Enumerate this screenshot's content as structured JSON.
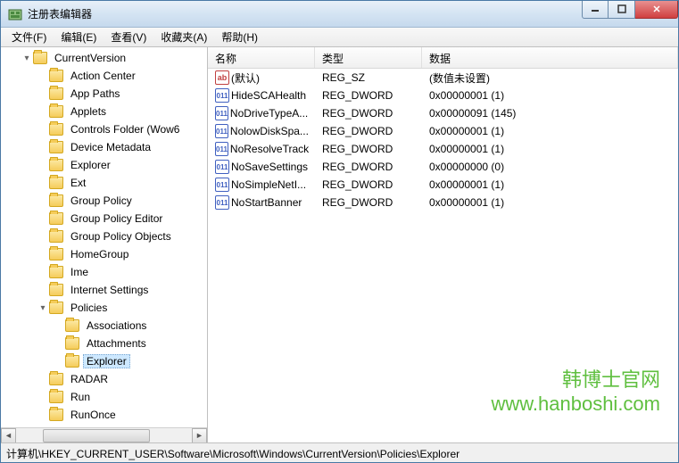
{
  "window": {
    "title": "注册表编辑器"
  },
  "menu": {
    "file": "文件(F)",
    "edit": "编辑(E)",
    "view": "查看(V)",
    "favorites": "收藏夹(A)",
    "help": "帮助(H)"
  },
  "tree": {
    "root": "CurrentVersion",
    "items": [
      "Action Center",
      "App Paths",
      "Applets",
      "Controls Folder (Wow6",
      "Device Metadata",
      "Explorer",
      "Ext",
      "Group Policy",
      "Group Policy Editor",
      "Group Policy Objects",
      "HomeGroup",
      "Ime",
      "Internet Settings"
    ],
    "policies": {
      "label": "Policies",
      "children": [
        "Associations",
        "Attachments",
        "Explorer"
      ]
    },
    "after": [
      "RADAR",
      "Run",
      "RunOnce"
    ]
  },
  "list": {
    "columns": {
      "name": "名称",
      "type": "类型",
      "data": "数据"
    },
    "col_widths": {
      "name": 120,
      "type": 120,
      "data": 260
    },
    "rows": [
      {
        "icon": "sz",
        "name": "(默认)",
        "type": "REG_SZ",
        "data": "(数值未设置)"
      },
      {
        "icon": "dw",
        "name": "HideSCAHealth",
        "type": "REG_DWORD",
        "data": "0x00000001 (1)"
      },
      {
        "icon": "dw",
        "name": "NoDriveTypeA...",
        "type": "REG_DWORD",
        "data": "0x00000091 (145)"
      },
      {
        "icon": "dw",
        "name": "NolowDiskSpa...",
        "type": "REG_DWORD",
        "data": "0x00000001 (1)"
      },
      {
        "icon": "dw",
        "name": "NoResolveTrack",
        "type": "REG_DWORD",
        "data": "0x00000001 (1)"
      },
      {
        "icon": "dw",
        "name": "NoSaveSettings",
        "type": "REG_DWORD",
        "data": "0x00000000 (0)"
      },
      {
        "icon": "dw",
        "name": "NoSimpleNetI...",
        "type": "REG_DWORD",
        "data": "0x00000001 (1)"
      },
      {
        "icon": "dw",
        "name": "NoStartBanner",
        "type": "REG_DWORD",
        "data": "0x00000001 (1)"
      }
    ]
  },
  "statusbar": {
    "path": "计算机\\HKEY_CURRENT_USER\\Software\\Microsoft\\Windows\\CurrentVersion\\Policies\\Explorer"
  },
  "watermark": {
    "line1": "韩博士官网",
    "line2": "www.hanboshi.com"
  }
}
